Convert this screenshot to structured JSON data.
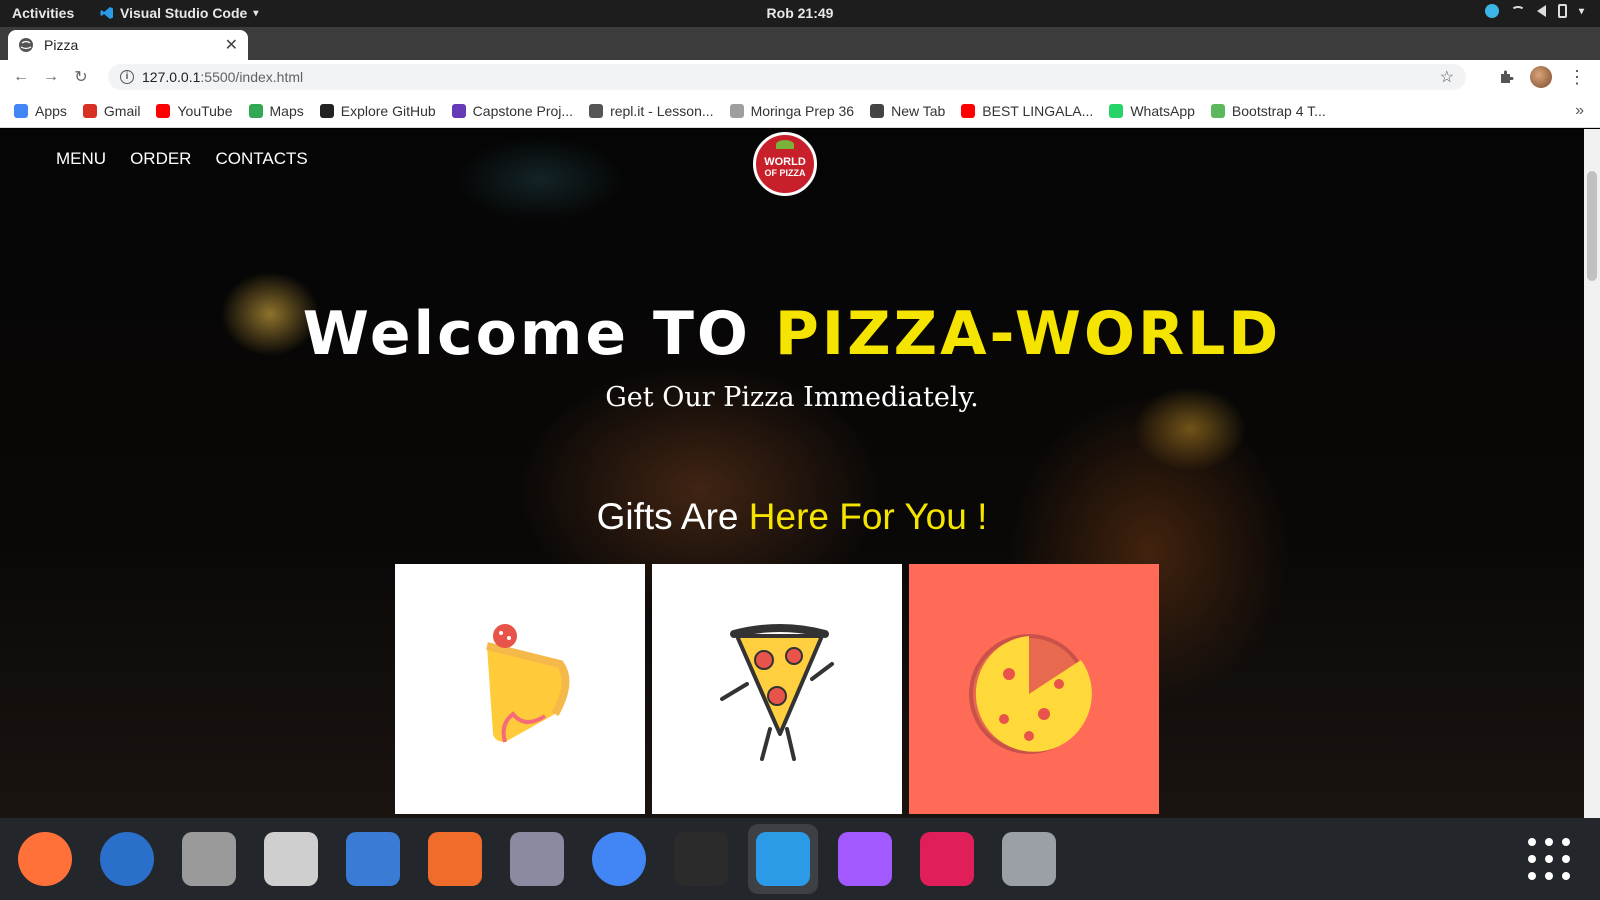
{
  "os": {
    "activities": "Activities",
    "app_name": "Visual Studio Code",
    "clock": "Rob 21:49"
  },
  "browser": {
    "tab_title": "Pizza",
    "url_host": "127.0.0.1",
    "url_rest": ":5500/index.html",
    "bookmarks": [
      {
        "label": "Apps",
        "icon": "apps-grid-icon",
        "color": "#4285f4"
      },
      {
        "label": "Gmail",
        "icon": "gmail-icon",
        "color": "#d93025"
      },
      {
        "label": "YouTube",
        "icon": "youtube-icon",
        "color": "#ff0000"
      },
      {
        "label": "Maps",
        "icon": "maps-icon",
        "color": "#34a853"
      },
      {
        "label": "Explore GitHub",
        "icon": "github-icon",
        "color": "#222222"
      },
      {
        "label": "Capstone Proj...",
        "icon": "document-icon",
        "color": "#673ab7"
      },
      {
        "label": "repl.it - Lesson...",
        "icon": "replit-icon",
        "color": "#555555"
      },
      {
        "label": "Moringa Prep 36",
        "icon": "moringa-icon",
        "color": "#9e9e9e"
      },
      {
        "label": "New Tab",
        "icon": "chrome-icon",
        "color": "#444444"
      },
      {
        "label": "BEST LINGALA...",
        "icon": "youtube-icon",
        "color": "#ff0000"
      },
      {
        "label": "WhatsApp",
        "icon": "whatsapp-icon",
        "color": "#25d366"
      },
      {
        "label": "Bootstrap 4 T...",
        "icon": "bootstrap-icon",
        "color": "#5cb85c"
      }
    ]
  },
  "site": {
    "nav": [
      "MENU",
      "ORDER",
      "CONTACTS"
    ],
    "logo_lines": [
      "WORLD",
      "OF PIZZA"
    ],
    "hero_title_prefix": "Welcome TO ",
    "hero_title_highlight": "PIZZA-WORLD",
    "hero_subtitle": "Get Our Pizza Immediately.",
    "gifts_prefix": "Gifts Are ",
    "gifts_highlight": "Here For You !",
    "accent_color": "#f5e400",
    "cards": [
      {
        "icon": "cheese-pizza-slice-icon",
        "bg": "#ffffff"
      },
      {
        "icon": "dancing-pizza-slice-icon",
        "bg": "#ffffff"
      },
      {
        "icon": "whole-pizza-icon",
        "bg": "#ff6b57"
      }
    ]
  },
  "dock": [
    {
      "icon": "firefox-icon"
    },
    {
      "icon": "thunderbird-icon"
    },
    {
      "icon": "files-icon"
    },
    {
      "icon": "rhythmbox-icon"
    },
    {
      "icon": "libreoffice-writer-icon"
    },
    {
      "icon": "software-center-icon"
    },
    {
      "icon": "image-viewer-icon"
    },
    {
      "icon": "chrome-icon"
    },
    {
      "icon": "terminal-icon"
    },
    {
      "icon": "vscode-icon"
    },
    {
      "icon": "figma-icon"
    },
    {
      "icon": "slack-icon"
    },
    {
      "icon": "settings-tools-icon"
    }
  ]
}
